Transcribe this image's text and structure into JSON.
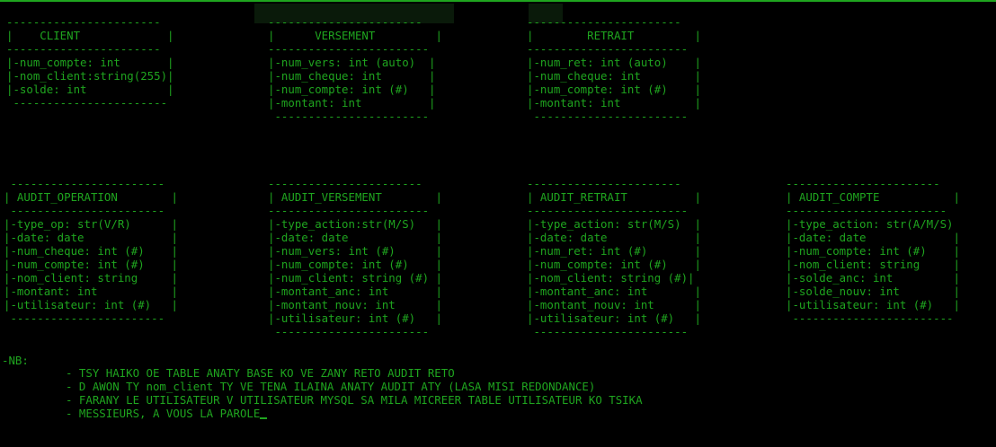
{
  "blocks": [
    "-----------------------  \n|    CLIENT             |\n-----------------------  \n|-num_compte: int       |\n|-nom_client:string(255)|\n|-solde: int            |\n -----------------------",
    "-----------------------\n|      VERSEMENT         |\n------------------------\n|-num_vers: int (auto)  |\n|-num_cheque: int       |\n|-num_compte: int (#)   |\n|-montant: int          |\n -----------------------",
    "-----------------------\n|        RETRAIT         |\n------------------------\n|-num_ret: int (auto)    |\n|-num_cheque: int        |\n|-num_compte: int (#)    |\n|-montant: int           |\n -----------------------",
    " -----------------------\n| AUDIT_OPERATION        |\n -----------------------\n|-type_op: str(V/R)      |\n|-date: date             |\n|-num_cheque: int (#)    |\n|-num_compte: int (#)    |\n|-nom_client: string     |\n|-montant: int           |\n|-utilisateur: int (#)   |\n -----------------------",
    "-----------------------\n| AUDIT_VERSEMENT        |\n------------------------\n|-type_action:str(M/S)   |\n|-date: date             |\n|-num_vers: int (#)      |\n|-num_compte: int (#)    |\n|-num_client: string (#) |\n|-montant_anc: int       |\n|-montant_nouv: int      |\n|-utilisateur: int (#)   |\n -----------------------",
    "-----------------------\n| AUDIT_RETRAIT          |\n------------------------\n|-type_action: str(M/S)  |\n|-date: date             |\n|-num_ret: int (#)       |\n|-num_compte: int (#)    |\n|-nom_client: string (#)|\n|-montant_anc: int       |\n|-montant_nouv: int      |\n|-utilisateur: int (#)   |\n -----------------------",
    "-----------------------\n| AUDIT_COMPTE           |\n------------------------\n|-type_action: str(A/M/S)\n|-date: date             |\n|-num_compte: int (#)    |\n|-nom_client: string     |\n|-solde_anc: int         |\n|-solde_nouv: int        |\n|-utilisateur: int (#)   |\n ------------------------"
  ],
  "nb": {
    "label": "-NB:",
    "items": [
      "- TSY HAIKO OE TABLE ANATY BASE KO VE ZANY RETO AUDIT RETO",
      "- D AWON TY nom_client TY VE TENA ILAINA ANATY AUDIT ATY (LASA MISI REDONDANCE)",
      "- FARANY LE UTILISATEUR V UTILISATEUR MYSQL SA MILA MICREER TABLE UTILISATEUR KO TSIKA",
      "- MESSIEURS, A VOUS LA PAROLE"
    ]
  },
  "colors": {
    "text": "#1fa51f",
    "background": "#000000"
  }
}
